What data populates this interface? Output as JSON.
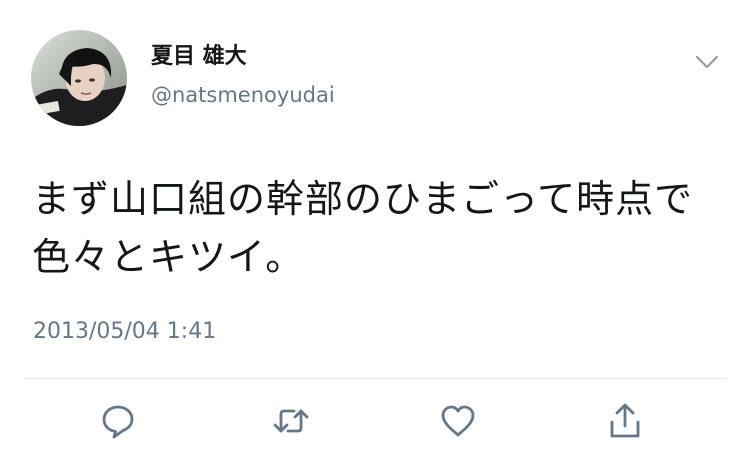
{
  "tweet": {
    "display_name": "夏目 雄大",
    "handle": "@natsmenoyudai",
    "text": "まず山口組の幹部のひまごって時点で色々とキツイ。",
    "timestamp": "2013/05/04 1:41"
  },
  "icons": {
    "menu": "chevron-down-icon",
    "reply": "reply-icon",
    "retweet": "retweet-icon",
    "like": "heart-icon",
    "share": "share-icon"
  },
  "colors": {
    "primary_text": "#14171a",
    "secondary_text": "#657786",
    "divider": "#e1e8ed",
    "icon": "#657786"
  }
}
